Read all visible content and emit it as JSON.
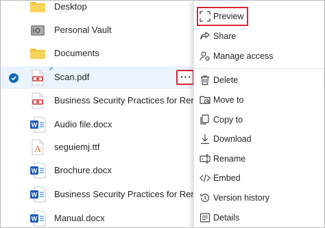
{
  "files": [
    {
      "name": "Desktop",
      "type": "folder"
    },
    {
      "name": "Personal Vault",
      "type": "vault"
    },
    {
      "name": "Documents",
      "type": "folder"
    },
    {
      "name": "Scan.pdf",
      "type": "pdf",
      "selected": true
    },
    {
      "name": "Business Security Practices for Remote Work.pdf",
      "type": "pdf"
    },
    {
      "name": "Audio file.docx",
      "type": "word"
    },
    {
      "name": "seguiemj.ttf",
      "type": "font"
    },
    {
      "name": "Brochure.docx",
      "type": "word"
    },
    {
      "name": "Business Security Practices for Remote Work.docx",
      "type": "word"
    },
    {
      "name": "Manual.docx",
      "type": "word"
    }
  ],
  "more_button": {
    "label": "···"
  },
  "menu": {
    "items": [
      {
        "label": "Preview",
        "icon": "preview-icon"
      },
      {
        "label": "Share",
        "icon": "share-icon"
      },
      {
        "label": "Manage access",
        "icon": "manage-access-icon"
      },
      {
        "label": "Delete",
        "icon": "delete-icon"
      },
      {
        "label": "Move to",
        "icon": "move-to-icon"
      },
      {
        "label": "Copy to",
        "icon": "copy-to-icon"
      },
      {
        "label": "Download",
        "icon": "download-icon"
      },
      {
        "label": "Rename",
        "icon": "rename-icon"
      },
      {
        "label": "Embed",
        "icon": "embed-icon"
      },
      {
        "label": "Version history",
        "icon": "version-history-icon"
      },
      {
        "label": "Details",
        "icon": "details-icon"
      }
    ]
  },
  "colors": {
    "accent": "#0f6cbd",
    "highlight": "#d9232e",
    "selected_row": "#ebf3fc",
    "folder": "#f3c540",
    "pdf": "#d13438",
    "word": "#185abd"
  }
}
